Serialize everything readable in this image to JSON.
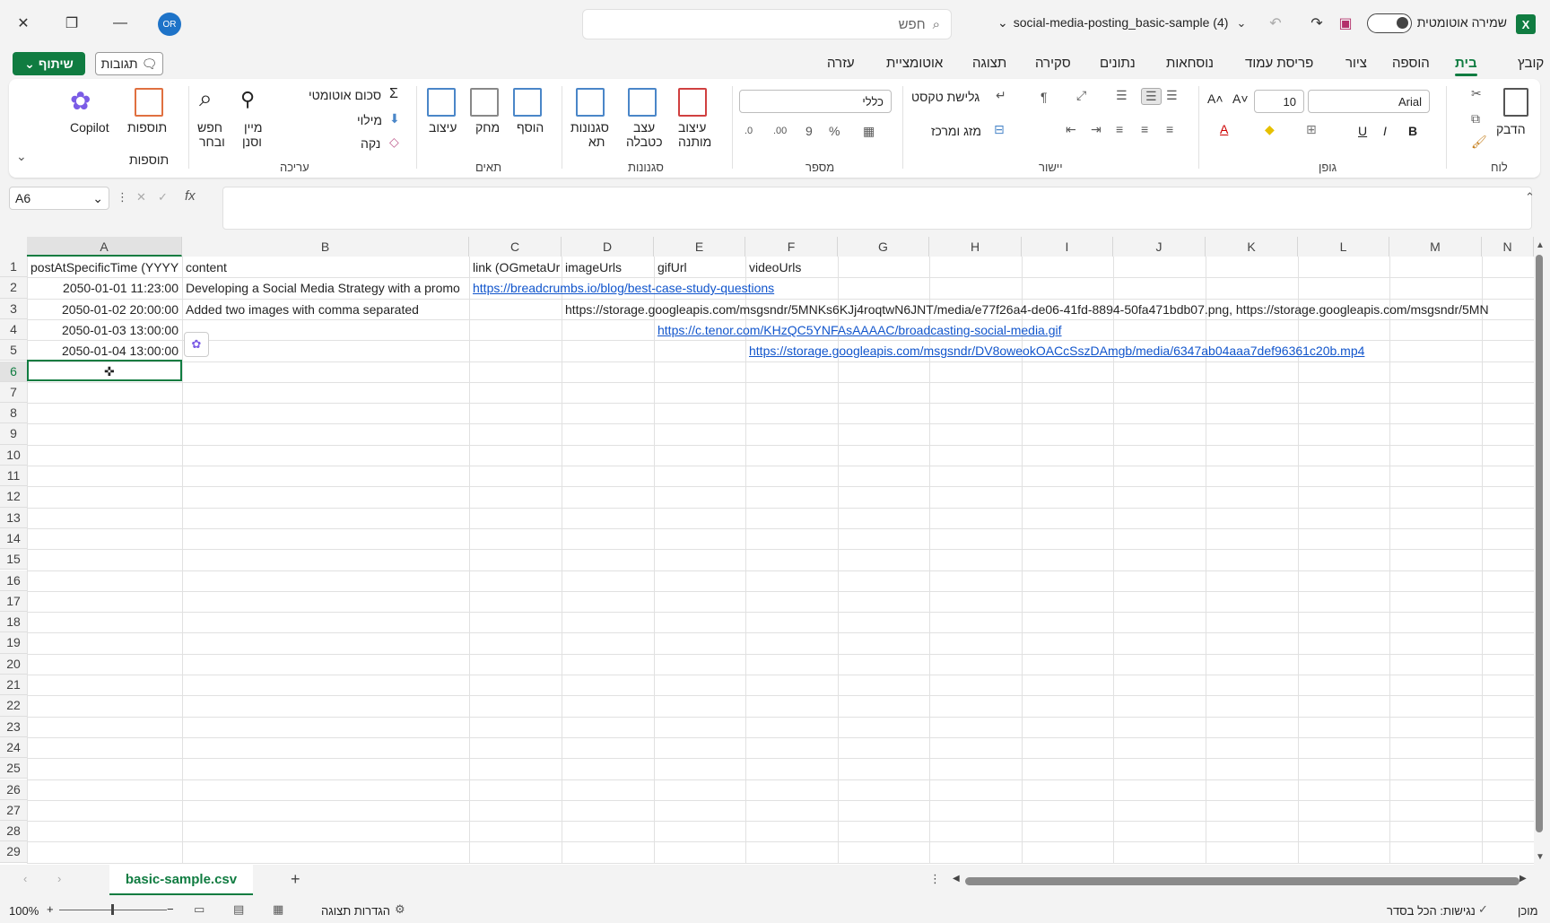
{
  "app": {
    "name": "Excel",
    "logo": "X"
  },
  "titlebar": {
    "autosave_label": "שמירה אוטומטית",
    "filename": "social-media-posting_basic-sample (4)",
    "search_placeholder": "חפש",
    "avatar_initials": "OR"
  },
  "menu_tabs": [
    "קובץ",
    "בית",
    "הוספה",
    "ציור",
    "פריסת עמוד",
    "נוסחאות",
    "נתונים",
    "סקירה",
    "תצוגה",
    "אוטומציית",
    "עזרה"
  ],
  "active_tab": "בית",
  "buttons": {
    "share": "שיתוף",
    "comments": "תגובות"
  },
  "ribbon": {
    "clipboard": {
      "label": "לוח",
      "paste": "הדבק"
    },
    "font": {
      "label": "גופן",
      "name": "Arial",
      "size": "10",
      "bold": "B",
      "italic": "I",
      "underline": "U"
    },
    "alignment": {
      "label": "יישור",
      "wrap": "גלישת טקסט",
      "merge": "מזג ומרכז"
    },
    "number": {
      "label": "מספר",
      "format": "כללי"
    },
    "styles": {
      "label": "סגנונות",
      "conditional": "עיצוב",
      "conditional2": "מותנה",
      "table": "עצב",
      "table2": "כטבלה",
      "cell": "סגנונות",
      "cell2": "תא"
    },
    "cells": {
      "label": "תאים",
      "insert": "הוסף",
      "delete": "מחק",
      "format": "עיצוב"
    },
    "editing": {
      "label": "עריכה",
      "autosum": "סכום אוטומטי",
      "fill": "מילוי",
      "clear": "נקה",
      "sort": "מיין",
      "sort2": "וסנן",
      "find": "חפש",
      "find2": "ובחר"
    },
    "addins": {
      "label": "תוספות",
      "addins": "תוספות",
      "copilot": "Copilot"
    }
  },
  "formula_bar": {
    "name_box": "A6",
    "fx": "fx",
    "value": ""
  },
  "columns": [
    "A",
    "B",
    "C",
    "D",
    "E",
    "F",
    "G",
    "H",
    "I",
    "J",
    "K",
    "L",
    "M",
    "N"
  ],
  "rows": [
    "1",
    "2",
    "3",
    "4",
    "5",
    "6",
    "7",
    "8",
    "9",
    "10",
    "11",
    "12",
    "13",
    "14",
    "15",
    "16",
    "17",
    "18",
    "19",
    "20",
    "21",
    "22",
    "23",
    "24",
    "25",
    "26",
    "27",
    "28",
    "29"
  ],
  "cells": {
    "A1": "postAtSpecificTime (YYYY",
    "B1": "content",
    "C1": "link (OGmetaUr",
    "D1": "imageUrls",
    "E1": "gifUrl",
    "F1": "videoUrls",
    "A2": "2050-01-01 11:23:00",
    "B2": "Developing a Social Media Strategy with a promo",
    "C2": "https://breadcrumbs.io/blog/best-case-study-questions",
    "A3": "2050-01-02 20:00:00",
    "B3": "Added two images with comma separated",
    "D3": "https://storage.googleapis.com/msgsndr/5MNKs6KJj4roqtwN6JNT/media/e77f26a4-de06-41fd-8894-50fa471bdb07.png, https://storage.googleapis.com/msgsndr/5MN",
    "A4": "2050-01-03 13:00:00",
    "E4": "https://c.tenor.com/KHzQC5YNFAsAAAAC/broadcasting-social-media.gif",
    "A5": "2050-01-04 13:00:00",
    "F5": "https://storage.googleapis.com/msgsndr/DV8oweokOACcSszDAmgb/media/6347ab04aaa7def96361c20b.mp4"
  },
  "sheet_tab": "basic-sample.csv",
  "status": {
    "ready": "מוכן",
    "accessibility": "נגישות: הכל בסדר",
    "display_settings": "הגדרות תצוגה",
    "zoom": "100%"
  }
}
